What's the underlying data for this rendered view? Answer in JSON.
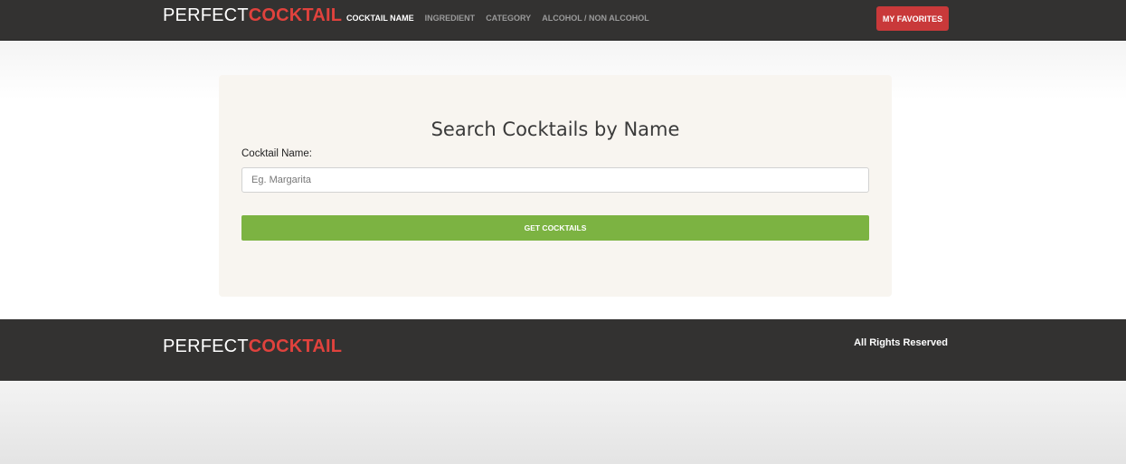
{
  "header": {
    "logo": {
      "part1": "PERFECT",
      "part2": "COCKTAIL"
    },
    "nav": [
      {
        "label": "COCKTAIL NAME",
        "active": true
      },
      {
        "label": "INGREDIENT",
        "active": false
      },
      {
        "label": "CATEGORY",
        "active": false
      },
      {
        "label": "ALCOHOL / NON ALCOHOL",
        "active": false
      }
    ],
    "favorites_label": "MY FAVORITES"
  },
  "search": {
    "title": "Search Cocktails by Name",
    "field_label": "Cocktail Name:",
    "placeholder": "Eg. Margarita",
    "value": "",
    "submit_label": "GET COCKTAILS"
  },
  "footer": {
    "logo": {
      "part1": "PERFECT",
      "part2": "COCKTAIL"
    },
    "rights": "All Rights Reserved"
  },
  "colors": {
    "nav_bg": "#333231",
    "brand_red": "#e0423d",
    "favorites_bg": "#c9393a",
    "submit_green": "#7cb342",
    "panel_bg": "#f8f5f0"
  }
}
